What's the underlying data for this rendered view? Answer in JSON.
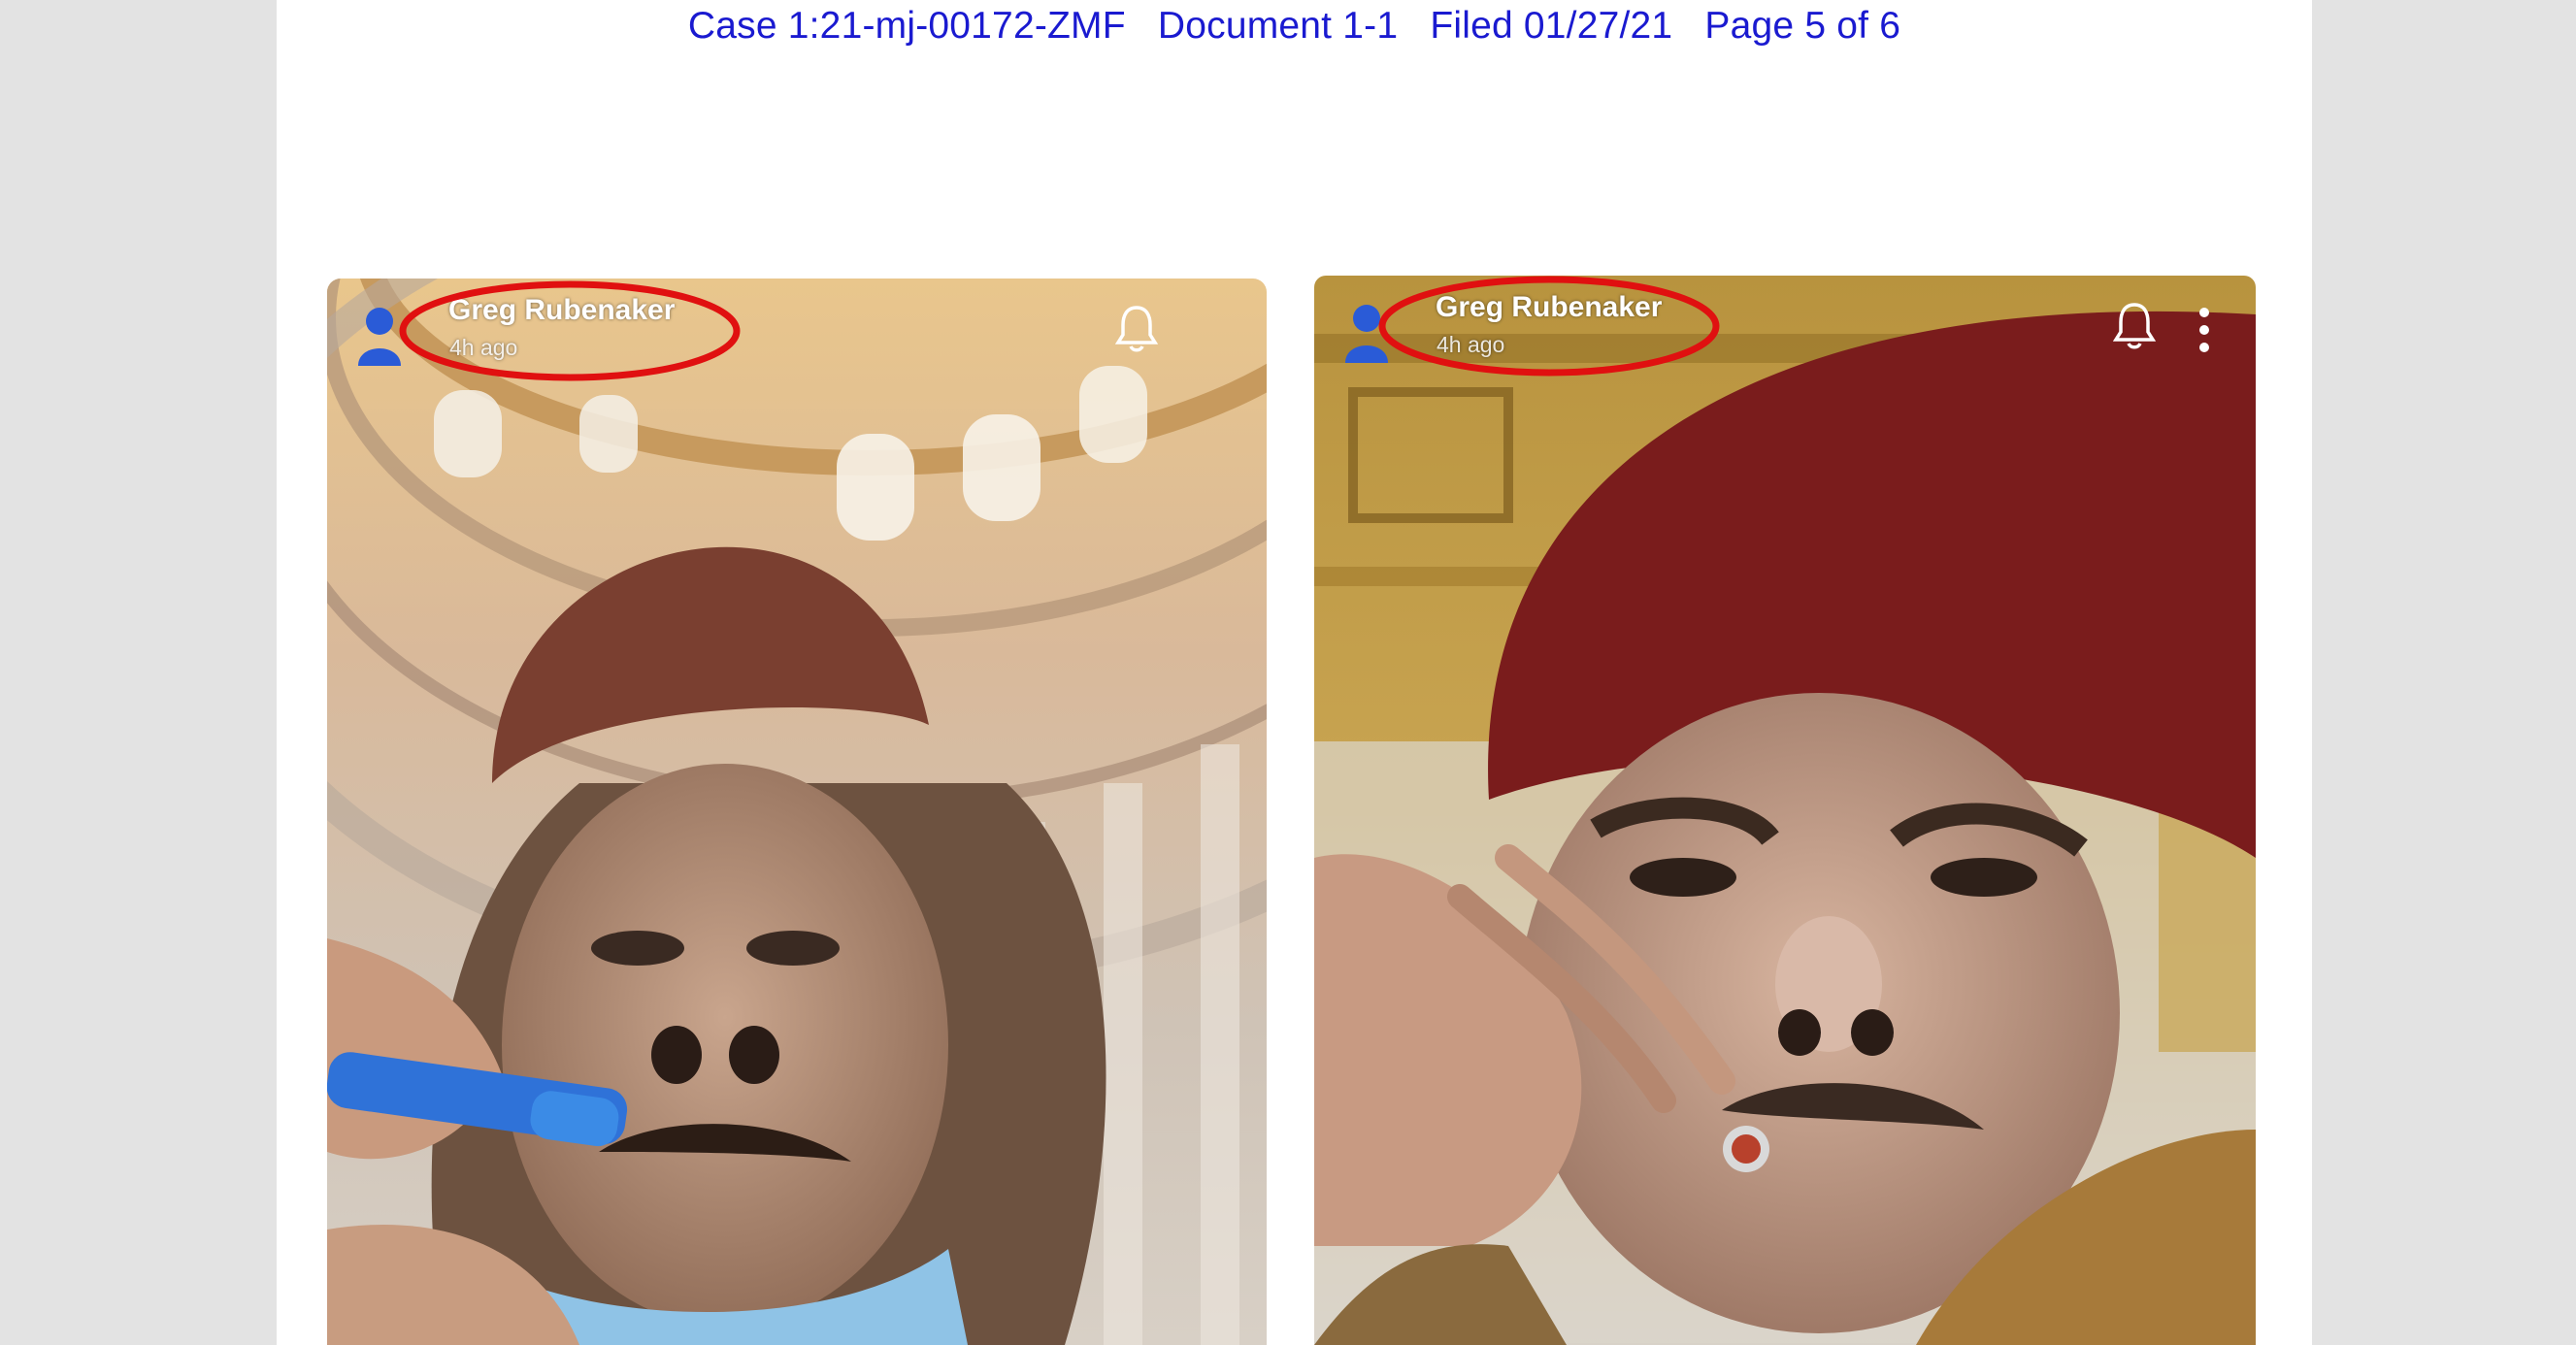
{
  "header": {
    "case_line": "Case 1:21-mj-00172-ZMF   Document 1-1   Filed 01/27/21   Page 5 of 6"
  },
  "panels": [
    {
      "username": "Greg Rubenaker",
      "timestamp": "4h ago",
      "icons": [
        "snapchat-avatar-icon",
        "bell-icon"
      ]
    },
    {
      "username": "Greg Rubenaker",
      "timestamp": "4h ago",
      "icons": [
        "snapchat-avatar-icon",
        "bell-icon",
        "more-vertical-icon"
      ]
    }
  ],
  "colors": {
    "header_text": "#1a1ad0",
    "highlight_ring": "#e01010",
    "avatar": "#2a5bd7"
  }
}
